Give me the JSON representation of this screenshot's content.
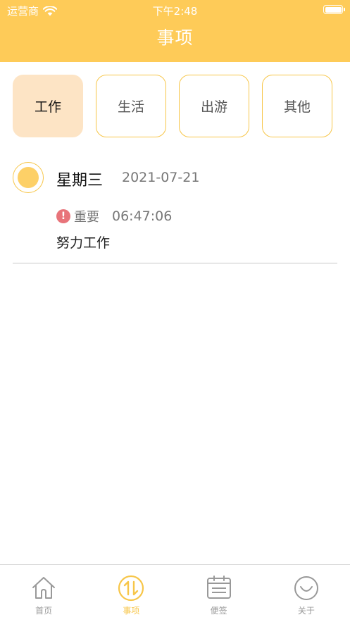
{
  "status_bar": {
    "carrier": "运营商",
    "time": "下午2:48"
  },
  "nav": {
    "title": "事项"
  },
  "categories": [
    {
      "label": "工作",
      "active": true
    },
    {
      "label": "生活",
      "active": false
    },
    {
      "label": "出游",
      "active": false
    },
    {
      "label": "其他",
      "active": false
    }
  ],
  "task": {
    "weekday": "星期三",
    "date": "2021-07-21",
    "priority_icon": "!",
    "priority": "重要",
    "time": "06:47:06",
    "content": "努力工作"
  },
  "tabbar": {
    "items": [
      {
        "label": "首页",
        "icon": "home-icon"
      },
      {
        "label": "事项",
        "icon": "sort-arrows-icon"
      },
      {
        "label": "便签",
        "icon": "notepad-icon"
      },
      {
        "label": "关于",
        "icon": "smile-icon"
      }
    ]
  },
  "colors": {
    "accent": "#FECB58",
    "active_category": "#FDE4C5",
    "alert": "#E8747A"
  }
}
